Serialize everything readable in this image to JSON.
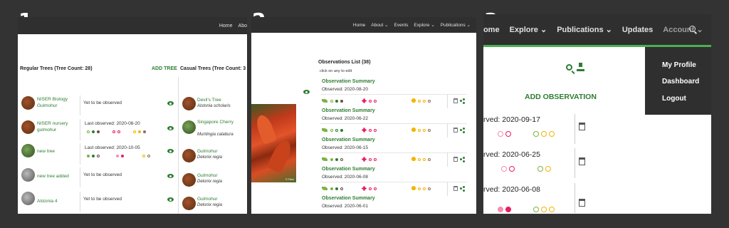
{
  "labels": {
    "n1": "1.",
    "n2": "2.",
    "n3": "3."
  },
  "panel1": {
    "nav": [
      "Home",
      "Abo"
    ],
    "regular_title": "Regular Trees (Tree Count: 28)",
    "add_tree": "ADD TREE",
    "casual_title": "Casual Trees (Tree Count: 3",
    "regular": [
      {
        "name": "NISER Biology",
        "name2": "Gulmohur",
        "status": "Yet to be observed"
      },
      {
        "name": "NISER nursery",
        "name2": "gulmohur",
        "status": "Last observed: 2020-08-20"
      },
      {
        "name": "new tree",
        "name2": "",
        "status": "Last observed: 2020-10-05"
      },
      {
        "name": "new tree added",
        "name2": "",
        "status": "Yet to be observed"
      },
      {
        "name": "Alstonia 4",
        "name2": "",
        "status": "Yet to be observed"
      }
    ],
    "casual": [
      {
        "name": "Devil's Tree",
        "sci": "Alstonia scholaris"
      },
      {
        "name": "Singapore Cherry",
        "sci": "Muntingia calabura"
      },
      {
        "name": "Gulmohur",
        "sci": "Delonix regia"
      },
      {
        "name": "Gulmohur",
        "sci": "Delonix regia"
      },
      {
        "name": "Gulmohur",
        "sci": "Delonix regia"
      }
    ]
  },
  "panel2": {
    "nav": [
      "Home",
      "About ⌄",
      "Events",
      "Explore ⌄",
      "Publications ⌄"
    ],
    "list_title": "Observations List (38)",
    "hint": "click on any to edit",
    "summary": "Observation Summary",
    "watermark": "© Flickr",
    "observations": [
      "Observed: 2020-08-20",
      "Observed: 2020-06-22",
      "Observed: 2020-06-15",
      "Observed: 2020-06-08",
      "Observed: 2020-06-01"
    ]
  },
  "panel3": {
    "nav": [
      "Home",
      "Explore ⌄",
      "Publications ⌄",
      "Updates",
      "Account ⌄"
    ],
    "dropdown": [
      "My Profile",
      "Dashboard",
      "Logout"
    ],
    "add_obs": "ADD OBSERVATION",
    "observed": [
      "rved: 2020-09-17",
      "rved: 2020-06-25",
      "rved: 2020-06-08"
    ]
  },
  "colors": {
    "green": "#2e7d32",
    "accent": "#4caf50",
    "dark": "#2f2f2f"
  }
}
